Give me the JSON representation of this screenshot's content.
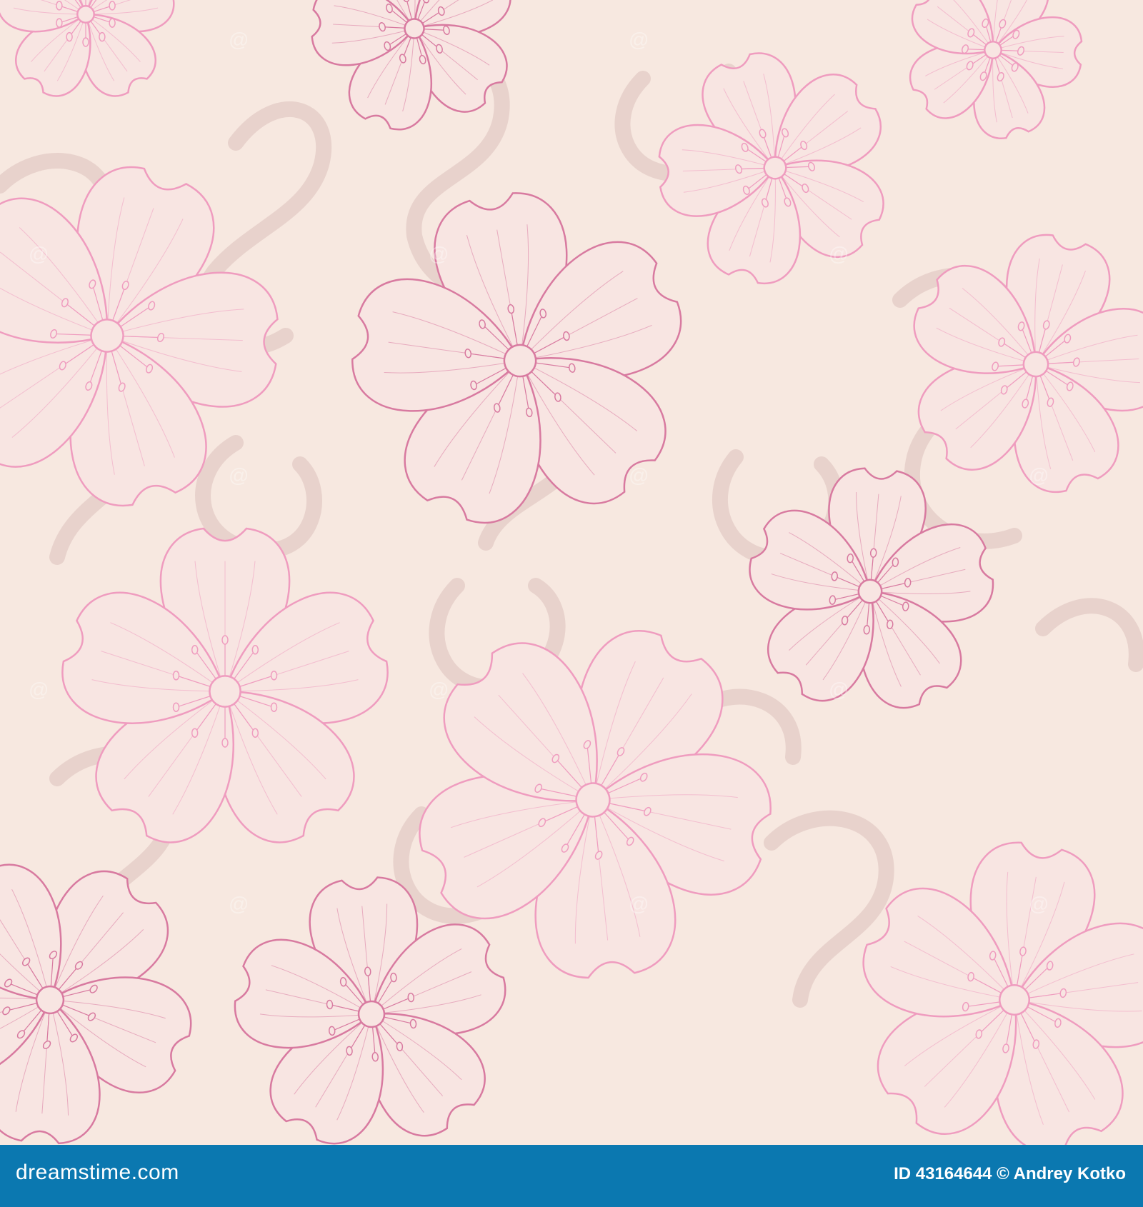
{
  "colors": {
    "background": "#f7e8e0",
    "swirl": "#e8d2cc",
    "petal_fill": "#f8e5e2",
    "outline_dark": "#d87aa0",
    "outline_light": "#ef9cbf",
    "footer": "#0b78b0",
    "footer_text": "#ffffff"
  },
  "footer": {
    "brand": "dreamstime.com",
    "id_label": "ID 43164644 © Andrey Kotko"
  },
  "watermark": {
    "icon": "swirl-watermark-icon"
  }
}
